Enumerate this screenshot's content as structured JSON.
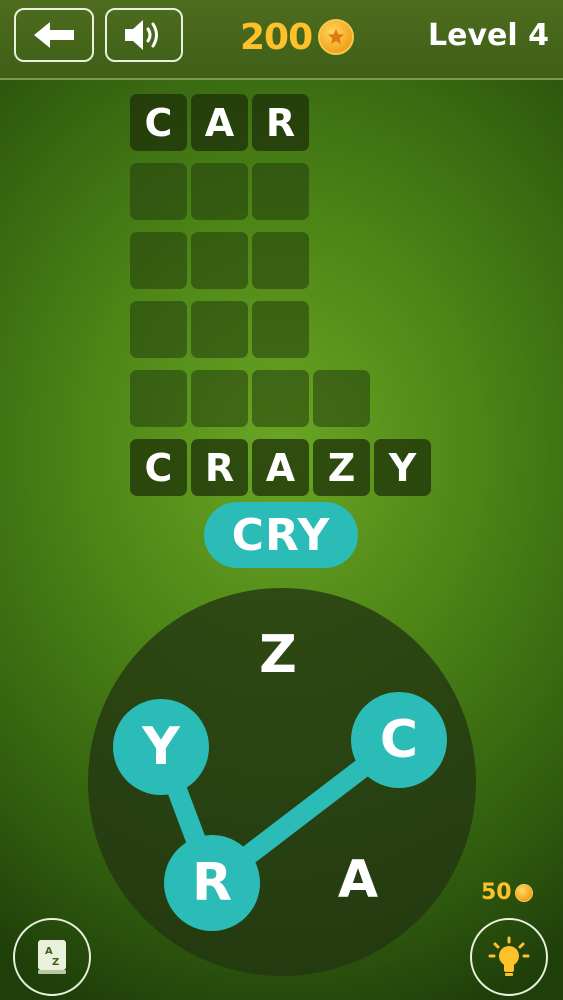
{
  "header": {
    "coins": "200",
    "level_label": "Level 4"
  },
  "board": {
    "rows": [
      {
        "letters": [
          "C",
          "A",
          "R"
        ],
        "revealed": true
      },
      {
        "letters": [
          "",
          "",
          ""
        ],
        "revealed": false
      },
      {
        "letters": [
          "",
          "",
          ""
        ],
        "revealed": false
      },
      {
        "letters": [
          "",
          "",
          ""
        ],
        "revealed": false
      },
      {
        "letters": [
          "",
          "",
          "",
          ""
        ],
        "revealed": false
      },
      {
        "letters": [
          "C",
          "R",
          "A",
          "Z",
          "Y"
        ],
        "revealed": true
      }
    ]
  },
  "current_word": "CRY",
  "wheel": {
    "letters": [
      {
        "char": "Z",
        "selected": false
      },
      {
        "char": "C",
        "selected": true
      },
      {
        "char": "A",
        "selected": false
      },
      {
        "char": "R",
        "selected": true
      },
      {
        "char": "Y",
        "selected": true
      }
    ]
  },
  "hint": {
    "cost": "50"
  },
  "colors": {
    "accent": "#2bbcb7",
    "coin": "#ffc12a"
  },
  "icons": {
    "back": "arrow-left-icon",
    "sound": "speaker-icon",
    "coin": "coin-icon",
    "dictionary": "dictionary-book-icon",
    "hint": "lightbulb-icon"
  }
}
